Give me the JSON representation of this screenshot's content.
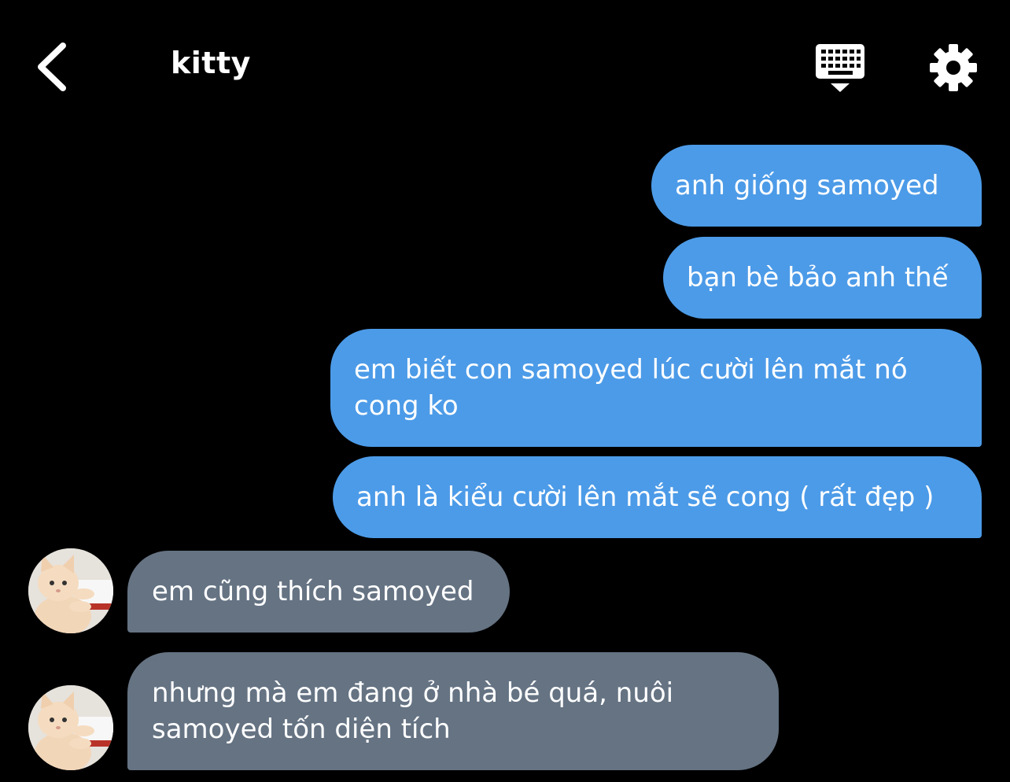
{
  "header": {
    "back_icon": "chevron-left-icon",
    "title": "kitty",
    "keyboard_icon": "keyboard-icon",
    "settings_icon": "gear-icon"
  },
  "messages": [
    {
      "direction": "sent",
      "text": "anh giống samoyed"
    },
    {
      "direction": "sent",
      "text": "bạn bè bảo anh thế"
    },
    {
      "direction": "sent",
      "text": "em biết con samoyed lúc cười lên mắt nó\ncong ko"
    },
    {
      "direction": "sent",
      "text": "anh là kiểu cười lên mắt sẽ cong ( rất đẹp )"
    },
    {
      "direction": "received",
      "text": "em cũng thích samoyed",
      "avatar": "cat-typing-avatar"
    },
    {
      "direction": "received",
      "text": "nhưng mà em đang ở nhà bé quá, nuôi\nsamoyed tốn diện tích",
      "avatar": "cat-typing-avatar"
    }
  ],
  "colors": {
    "background": "#000000",
    "sent_bubble": "#4c9be8",
    "received_bubble": "#657383",
    "text": "#ffffff"
  }
}
